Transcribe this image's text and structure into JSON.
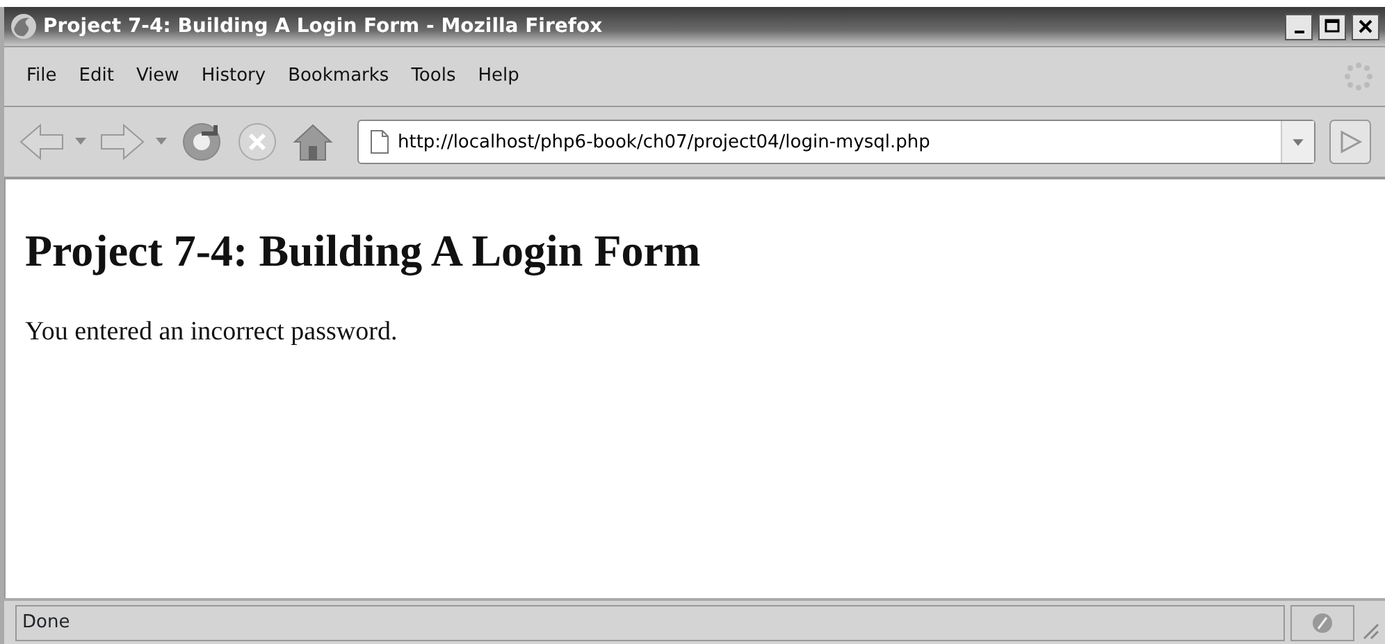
{
  "window": {
    "title": "Project 7-4: Building A Login Form - Mozilla Firefox"
  },
  "menu": [
    "File",
    "Edit",
    "View",
    "History",
    "Bookmarks",
    "Tools",
    "Help"
  ],
  "toolbar": [
    {
      "kind": "back",
      "disabled": true
    },
    {
      "kind": "forward",
      "disabled": true
    },
    {
      "kind": "reload",
      "disabled": false
    },
    {
      "kind": "stop",
      "disabled": true
    },
    {
      "kind": "home",
      "disabled": false
    }
  ],
  "address": {
    "value": "http://localhost/php6-book/ch07/project04/login-mysql.php"
  },
  "page": {
    "heading": "Project 7-4: Building A Login Form",
    "message": "You entered an incorrect password."
  },
  "status_bar": {
    "text": "Done"
  }
}
